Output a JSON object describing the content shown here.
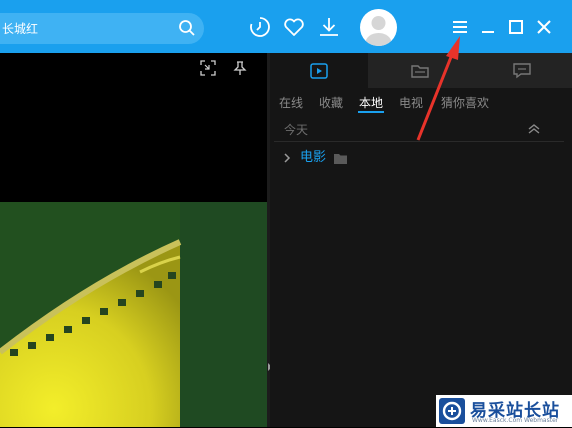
{
  "search": {
    "value": "长城红"
  },
  "topbar_icons": [
    "search-icon",
    "history-icon",
    "favorite-heart-icon",
    "download-icon",
    "user-avatar",
    "menu-icon",
    "minimize-icon",
    "maximize-icon",
    "close-icon"
  ],
  "panel": {
    "main_tabs": [
      "play-list-icon",
      "folder-icon",
      "message-icon"
    ],
    "sub_tabs": [
      "在线",
      "收藏",
      "本地",
      "电视",
      "猜你喜欢"
    ],
    "active_sub_tab": "本地",
    "group_label": "今天",
    "folder": {
      "label": "电影"
    }
  },
  "watermark": {
    "title": "易采站长站",
    "subtitle": "Www.Easck.Com  Webmaster"
  },
  "colors": {
    "accent": "#1aa0ee",
    "panel_bg": "#151515",
    "annotation": "#e8332a"
  }
}
